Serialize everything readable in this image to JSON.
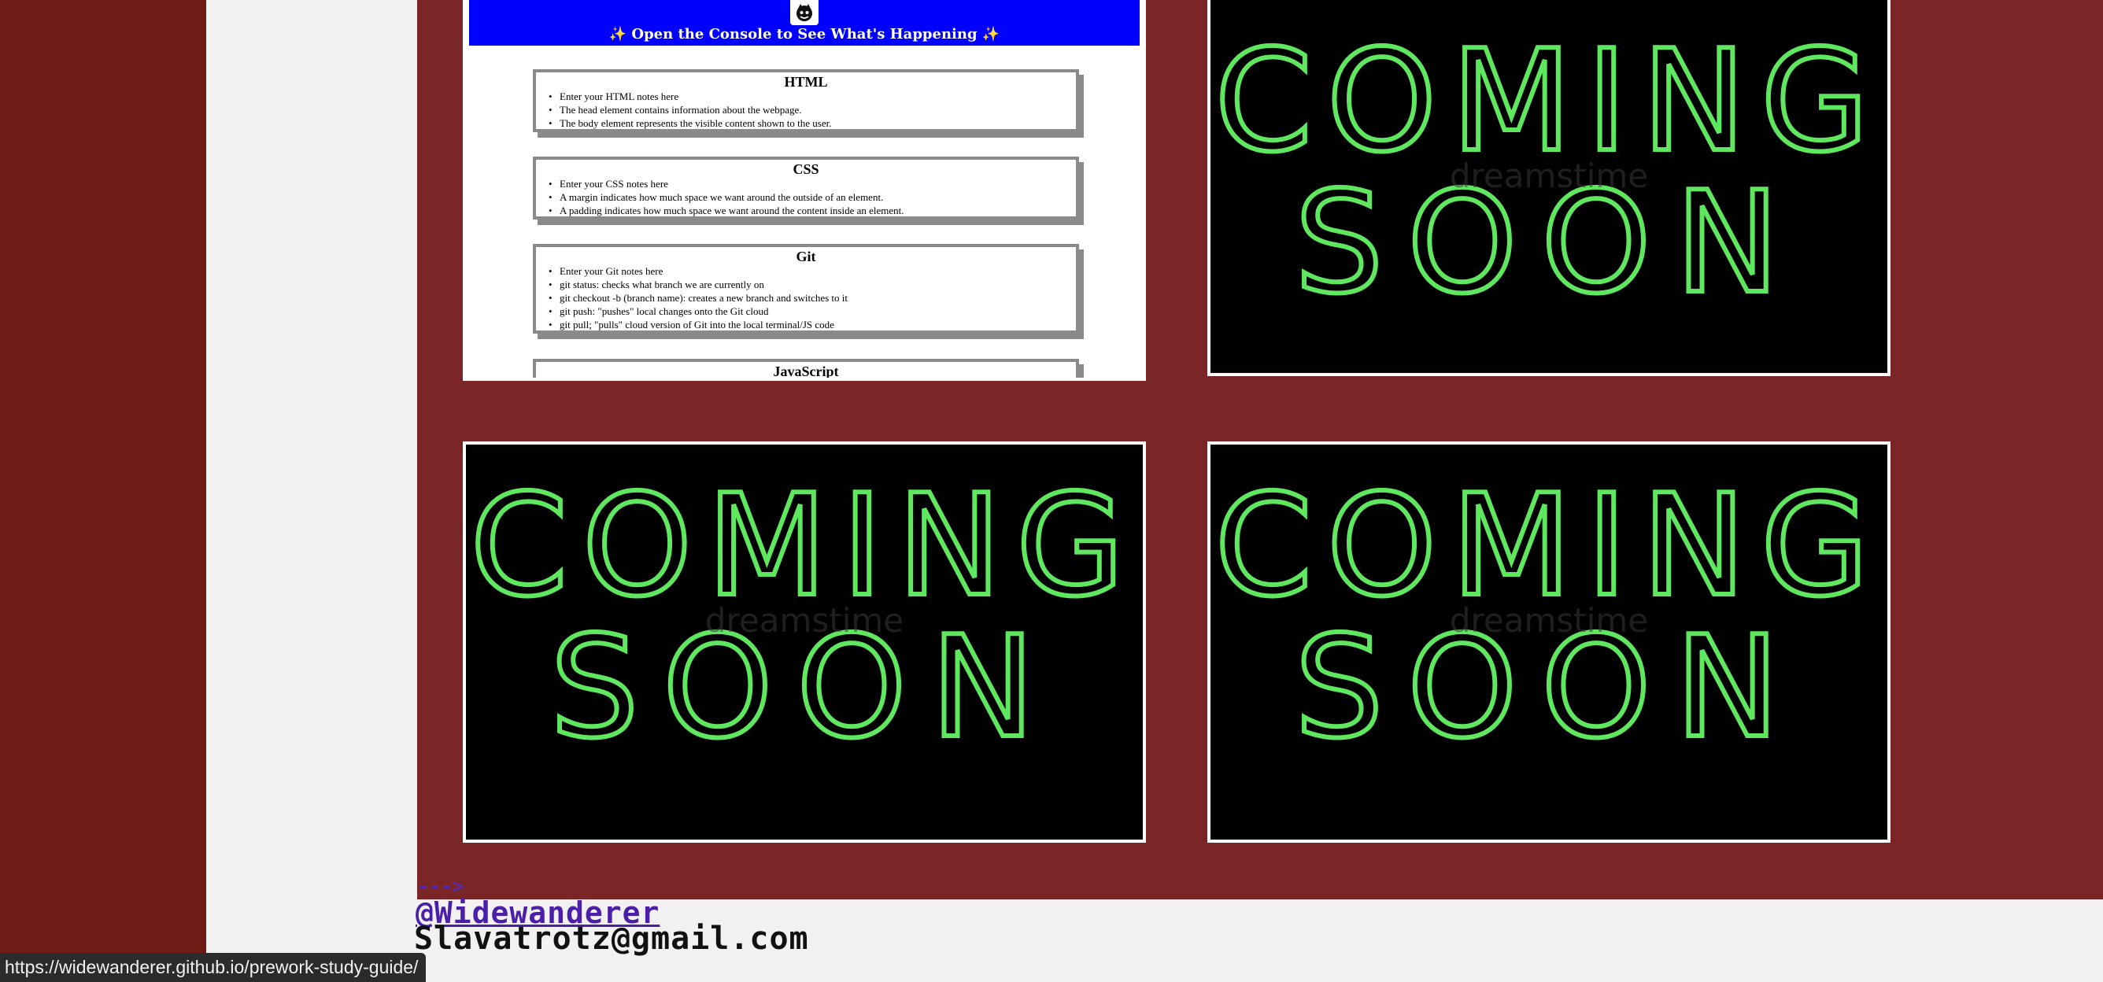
{
  "guide": {
    "logo_icon": "cat-logo-icon",
    "title": "✨ Open the Console to See What's Happening ✨",
    "topics": [
      {
        "title": "HTML",
        "notes": [
          "Enter your HTML notes here",
          "The head element contains information about the webpage.",
          "The body element represents the visible content shown to the user."
        ]
      },
      {
        "title": "CSS",
        "notes": [
          "Enter your CSS notes here",
          "A margin indicates how much space we want around the outside of an element.",
          "A padding indicates how much space we want around the content inside an element."
        ]
      },
      {
        "title": "Git",
        "notes": [
          "Enter your Git notes here",
          "git status: checks what branch we are currently on",
          "git checkout -b (branch name): creates a new branch and switches to it",
          "git push: \"pushes\" local changes onto the Git cloud",
          "git pull; \"pulls\" cloud version of Git into the local terminal/JS code"
        ]
      },
      {
        "title": "JavaScript",
        "notes": []
      }
    ]
  },
  "placeholders": {
    "word1": "COMING",
    "word2": "SOON",
    "watermark": "dreamstime",
    "neon_color": "#5fe85f"
  },
  "footer": {
    "arrow": "--->",
    "handle": "@Widewanderer",
    "email": "Slavatrotz@gmail.com"
  },
  "status_bar": {
    "url": "https://widewanderer.github.io/prework-study-guide/"
  },
  "colors": {
    "left_band": "#6e1a15",
    "main_panel": "#7b2626",
    "guide_header": "#0000ff"
  }
}
